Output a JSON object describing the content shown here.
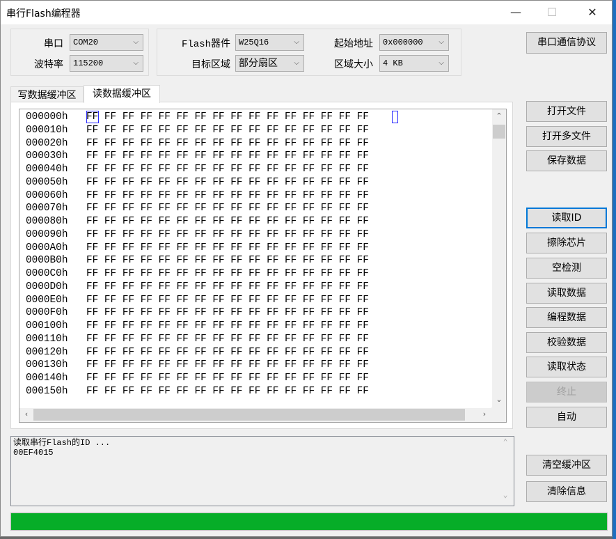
{
  "window": {
    "title": "串行Flash编程器",
    "minimize": "—",
    "maximize": "☐",
    "close": "✕"
  },
  "settings": {
    "port_label": "串口",
    "port_value": "COM20",
    "baud_label": "波特率",
    "baud_value": "115200",
    "flash_label": "Flash器件",
    "flash_value": "W25Q16",
    "target_label": "目标区域",
    "target_value": "部分扇区",
    "start_label": "起始地址",
    "start_value": "0x000000",
    "size_label": "区域大小",
    "size_value": "4 KB",
    "protocol_button": "串口通信协议"
  },
  "tabs": [
    {
      "label": "写数据缓冲区",
      "active": false
    },
    {
      "label": "读数据缓冲区",
      "active": true
    }
  ],
  "hex_rows": [
    {
      "addr": "000000h",
      "bytes": "FF FF FF FF FF FF FF FF FF FF FF FF FF FF FF FF"
    },
    {
      "addr": "000010h",
      "bytes": "FF FF FF FF FF FF FF FF FF FF FF FF FF FF FF FF"
    },
    {
      "addr": "000020h",
      "bytes": "FF FF FF FF FF FF FF FF FF FF FF FF FF FF FF FF"
    },
    {
      "addr": "000030h",
      "bytes": "FF FF FF FF FF FF FF FF FF FF FF FF FF FF FF FF"
    },
    {
      "addr": "000040h",
      "bytes": "FF FF FF FF FF FF FF FF FF FF FF FF FF FF FF FF"
    },
    {
      "addr": "000050h",
      "bytes": "FF FF FF FF FF FF FF FF FF FF FF FF FF FF FF FF"
    },
    {
      "addr": "000060h",
      "bytes": "FF FF FF FF FF FF FF FF FF FF FF FF FF FF FF FF"
    },
    {
      "addr": "000070h",
      "bytes": "FF FF FF FF FF FF FF FF FF FF FF FF FF FF FF FF"
    },
    {
      "addr": "000080h",
      "bytes": "FF FF FF FF FF FF FF FF FF FF FF FF FF FF FF FF"
    },
    {
      "addr": "000090h",
      "bytes": "FF FF FF FF FF FF FF FF FF FF FF FF FF FF FF FF"
    },
    {
      "addr": "0000A0h",
      "bytes": "FF FF FF FF FF FF FF FF FF FF FF FF FF FF FF FF"
    },
    {
      "addr": "0000B0h",
      "bytes": "FF FF FF FF FF FF FF FF FF FF FF FF FF FF FF FF"
    },
    {
      "addr": "0000C0h",
      "bytes": "FF FF FF FF FF FF FF FF FF FF FF FF FF FF FF FF"
    },
    {
      "addr": "0000D0h",
      "bytes": "FF FF FF FF FF FF FF FF FF FF FF FF FF FF FF FF"
    },
    {
      "addr": "0000E0h",
      "bytes": "FF FF FF FF FF FF FF FF FF FF FF FF FF FF FF FF"
    },
    {
      "addr": "0000F0h",
      "bytes": "FF FF FF FF FF FF FF FF FF FF FF FF FF FF FF FF"
    },
    {
      "addr": "000100h",
      "bytes": "FF FF FF FF FF FF FF FF FF FF FF FF FF FF FF FF"
    },
    {
      "addr": "000110h",
      "bytes": "FF FF FF FF FF FF FF FF FF FF FF FF FF FF FF FF"
    },
    {
      "addr": "000120h",
      "bytes": "FF FF FF FF FF FF FF FF FF FF FF FF FF FF FF FF"
    },
    {
      "addr": "000130h",
      "bytes": "FF FF FF FF FF FF FF FF FF FF FF FF FF FF FF FF"
    },
    {
      "addr": "000140h",
      "bytes": "FF FF FF FF FF FF FF FF FF FF FF FF FF FF FF FF"
    },
    {
      "addr": "000150h",
      "bytes": "FF FF FF FF FF FF FF FF FF FF FF FF FF FF FF FF"
    }
  ],
  "buttons": {
    "open_file": "打开文件",
    "open_multi": "打开多文件",
    "save_data": "保存数据",
    "read_id": "读取ID",
    "erase_chip": "擦除芯片",
    "blank_check": "空检测",
    "read_data": "读取数据",
    "program_data": "编程数据",
    "verify_data": "校验数据",
    "read_status": "读取状态",
    "stop": "终止",
    "auto": "自动",
    "clear_buffer": "清空缓冲区",
    "clear_info": "清除信息"
  },
  "log": {
    "lines": [
      "读取串行Flash的ID ...",
      "00EF4015"
    ]
  },
  "progress": {
    "percent": 100,
    "color": "#06ad28"
  }
}
